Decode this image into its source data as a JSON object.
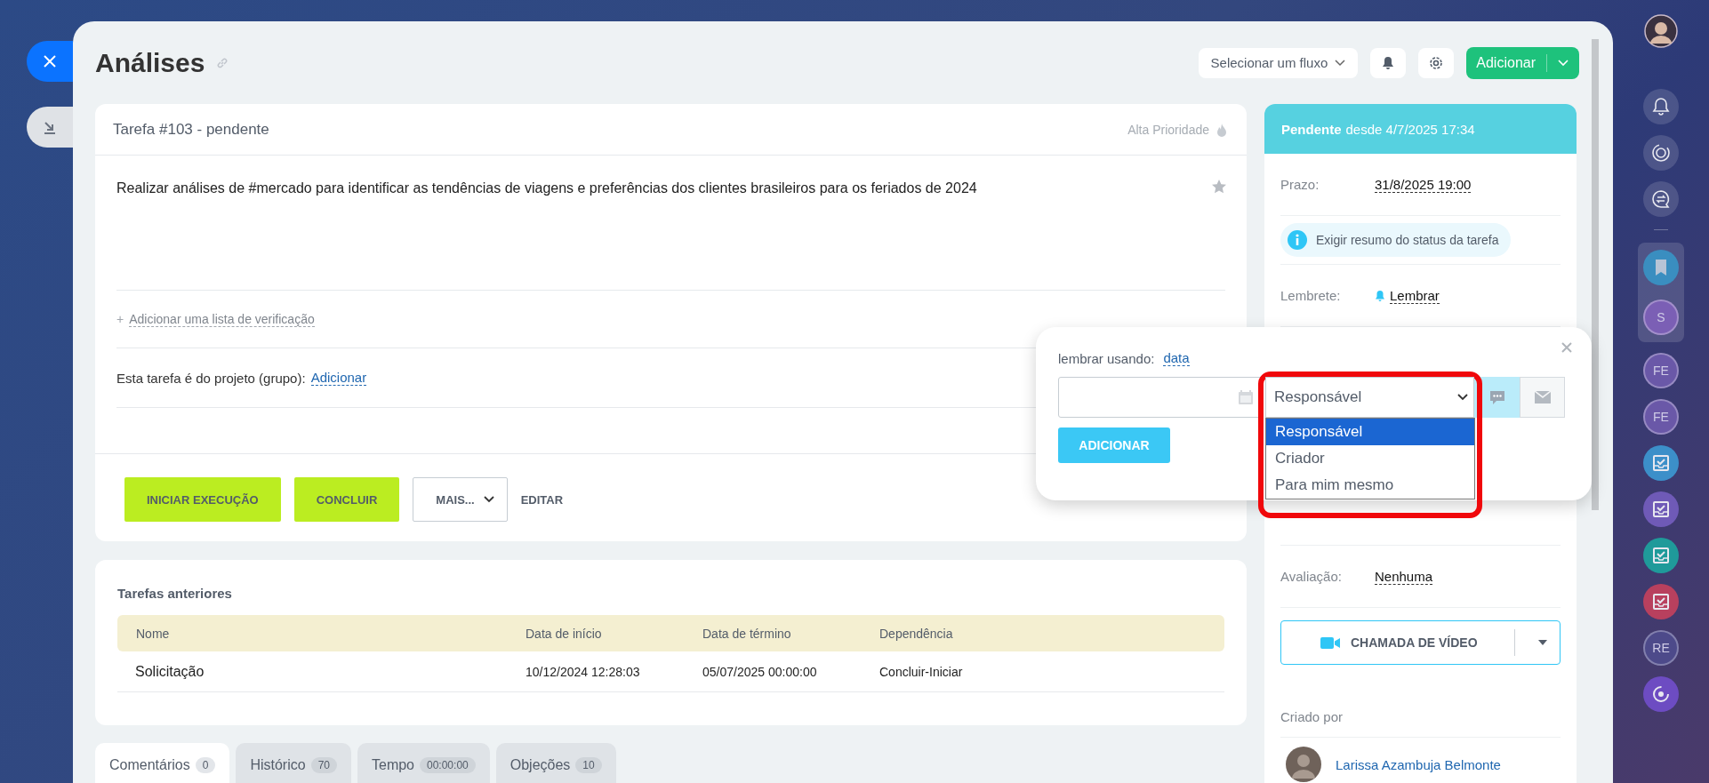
{
  "page": {
    "title": "Análises"
  },
  "toolbar": {
    "flow_select": "Selecionar um fluxo",
    "add_button": "Adicionar"
  },
  "task": {
    "header": "Tarefa #103 - pendente",
    "priority": "Alta Prioridade",
    "description": "Realizar análises de #mercado para identificar as tendências de viagens e preferências dos clientes brasileiros para os feriados de 2024",
    "checklist_prefix": "+",
    "checklist_link": "Adicionar uma lista de verificação",
    "project_label": "Esta tarefa é do projeto (grupo):",
    "project_link": "Adicionar",
    "actions": [
      {
        "label": "INICIAR EXECUÇÃO",
        "kind": "primary"
      },
      {
        "label": "CONCLUIR",
        "kind": "primary"
      },
      {
        "label": "MAIS...",
        "kind": "dropdown"
      },
      {
        "label": "EDITAR",
        "kind": "link"
      }
    ]
  },
  "previous_tasks": {
    "title": "Tarefas anteriores",
    "columns": [
      "Nome",
      "Data de início",
      "Data de término",
      "Dependência"
    ],
    "rows": [
      [
        "Solicitação",
        "10/12/2024 12:28:03",
        "05/07/2025 00:00:00",
        "Concluir-Iniciar"
      ]
    ]
  },
  "tabs": [
    {
      "label": "Comentários",
      "count": "0",
      "selected": true
    },
    {
      "label": "Histórico",
      "count": "70",
      "selected": false
    },
    {
      "label": "Tempo",
      "count": "00:00:00",
      "selected": false
    },
    {
      "label": "Objeções",
      "count": "10",
      "selected": false
    }
  ],
  "status": {
    "state": "Pendente",
    "since": "desde 4/7/2025 17:34"
  },
  "deadline": {
    "label": "Prazo:",
    "value": "31/8/2025 19:00"
  },
  "status_summary": "Exigir resumo do status da tarefa",
  "reminder": {
    "label": "Lembrete:",
    "value": "Lembrar"
  },
  "rating": {
    "label": "Avaliação:",
    "value": "Nenhuma"
  },
  "video_call": "CHAMADA DE VÍDEO",
  "created_by": {
    "label": "Criado por",
    "name": "Larissa Azambuja Belmonte"
  },
  "reminder_popup": {
    "label": "lembrar usando:",
    "mode_link": "data",
    "recipient": "Responsável",
    "options": [
      {
        "label": "Responsável",
        "selected": true
      },
      {
        "label": "Criador",
        "selected": false
      },
      {
        "label": "Para mim mesmo",
        "selected": false
      }
    ],
    "channels": [
      {
        "kind": "chat",
        "selected": true
      },
      {
        "kind": "email",
        "selected": false
      }
    ],
    "add_button": "ADICIONAR"
  },
  "rail_groups": [
    {
      "initials": "S",
      "color": "#7b5fb5"
    }
  ],
  "rail_avatars": [
    {
      "initials": "FE",
      "color": "#6a58a8"
    },
    {
      "initials": "FE",
      "color": "#6a58a8"
    }
  ],
  "rail_tasks": [
    {
      "color": "#3c8fc9"
    },
    {
      "color": "#6f5ab7"
    },
    {
      "color": "#1f9a9a"
    },
    {
      "color": "#b8405e"
    }
  ],
  "rail_bottom": [
    {
      "initials": "RE",
      "color": "#4d4a8a"
    }
  ]
}
